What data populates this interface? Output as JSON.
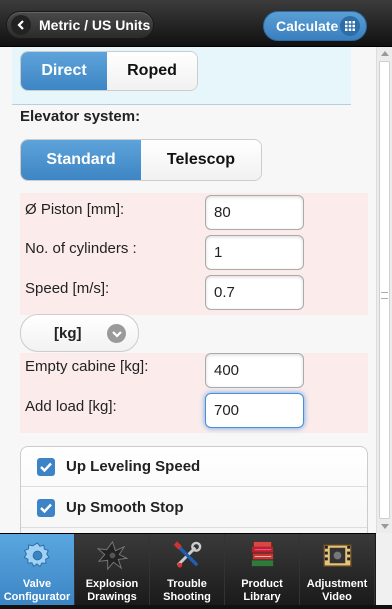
{
  "header": {
    "back_label": "Metric / US Units",
    "calculate_label": "Calculate"
  },
  "drive_type": {
    "options": [
      "Direct",
      "Roped"
    ],
    "selected": "Direct"
  },
  "elevator_system": {
    "label": "Elevator system:",
    "options": [
      "Standard",
      "Telescop"
    ],
    "selected": "Standard"
  },
  "fields": {
    "piston": {
      "label": "Ø Piston [mm]:",
      "value": "80"
    },
    "cylinders": {
      "label": "No. of cylinders :",
      "value": "1"
    },
    "speed": {
      "label": "Speed [m/s]:",
      "value": "0.7"
    }
  },
  "unit_select": {
    "value": "[kg]"
  },
  "load_fields": {
    "empty_cabine": {
      "label": "Empty cabine [kg]:",
      "value": "400"
    },
    "add_load": {
      "label": "Add load [kg]:",
      "value": "700"
    }
  },
  "options": [
    {
      "label": "Up Leveling Speed",
      "checked": true
    },
    {
      "label": "Up Smooth Stop",
      "checked": true
    }
  ],
  "nav": [
    {
      "label": "Valve Configurator",
      "icon": "gear-icon",
      "active": true
    },
    {
      "label": "Explosion Drawings",
      "icon": "explosion-icon",
      "active": false
    },
    {
      "label": "Trouble Shooting",
      "icon": "tools-icon",
      "active": false
    },
    {
      "label": "Product Library",
      "icon": "books-icon",
      "active": false
    },
    {
      "label": "Adjustment Video",
      "icon": "film-icon",
      "active": false
    }
  ],
  "colors": {
    "accent": "#3d85c4",
    "pink_bg": "#fbeceb",
    "blue_bg": "#e6f6fb"
  }
}
